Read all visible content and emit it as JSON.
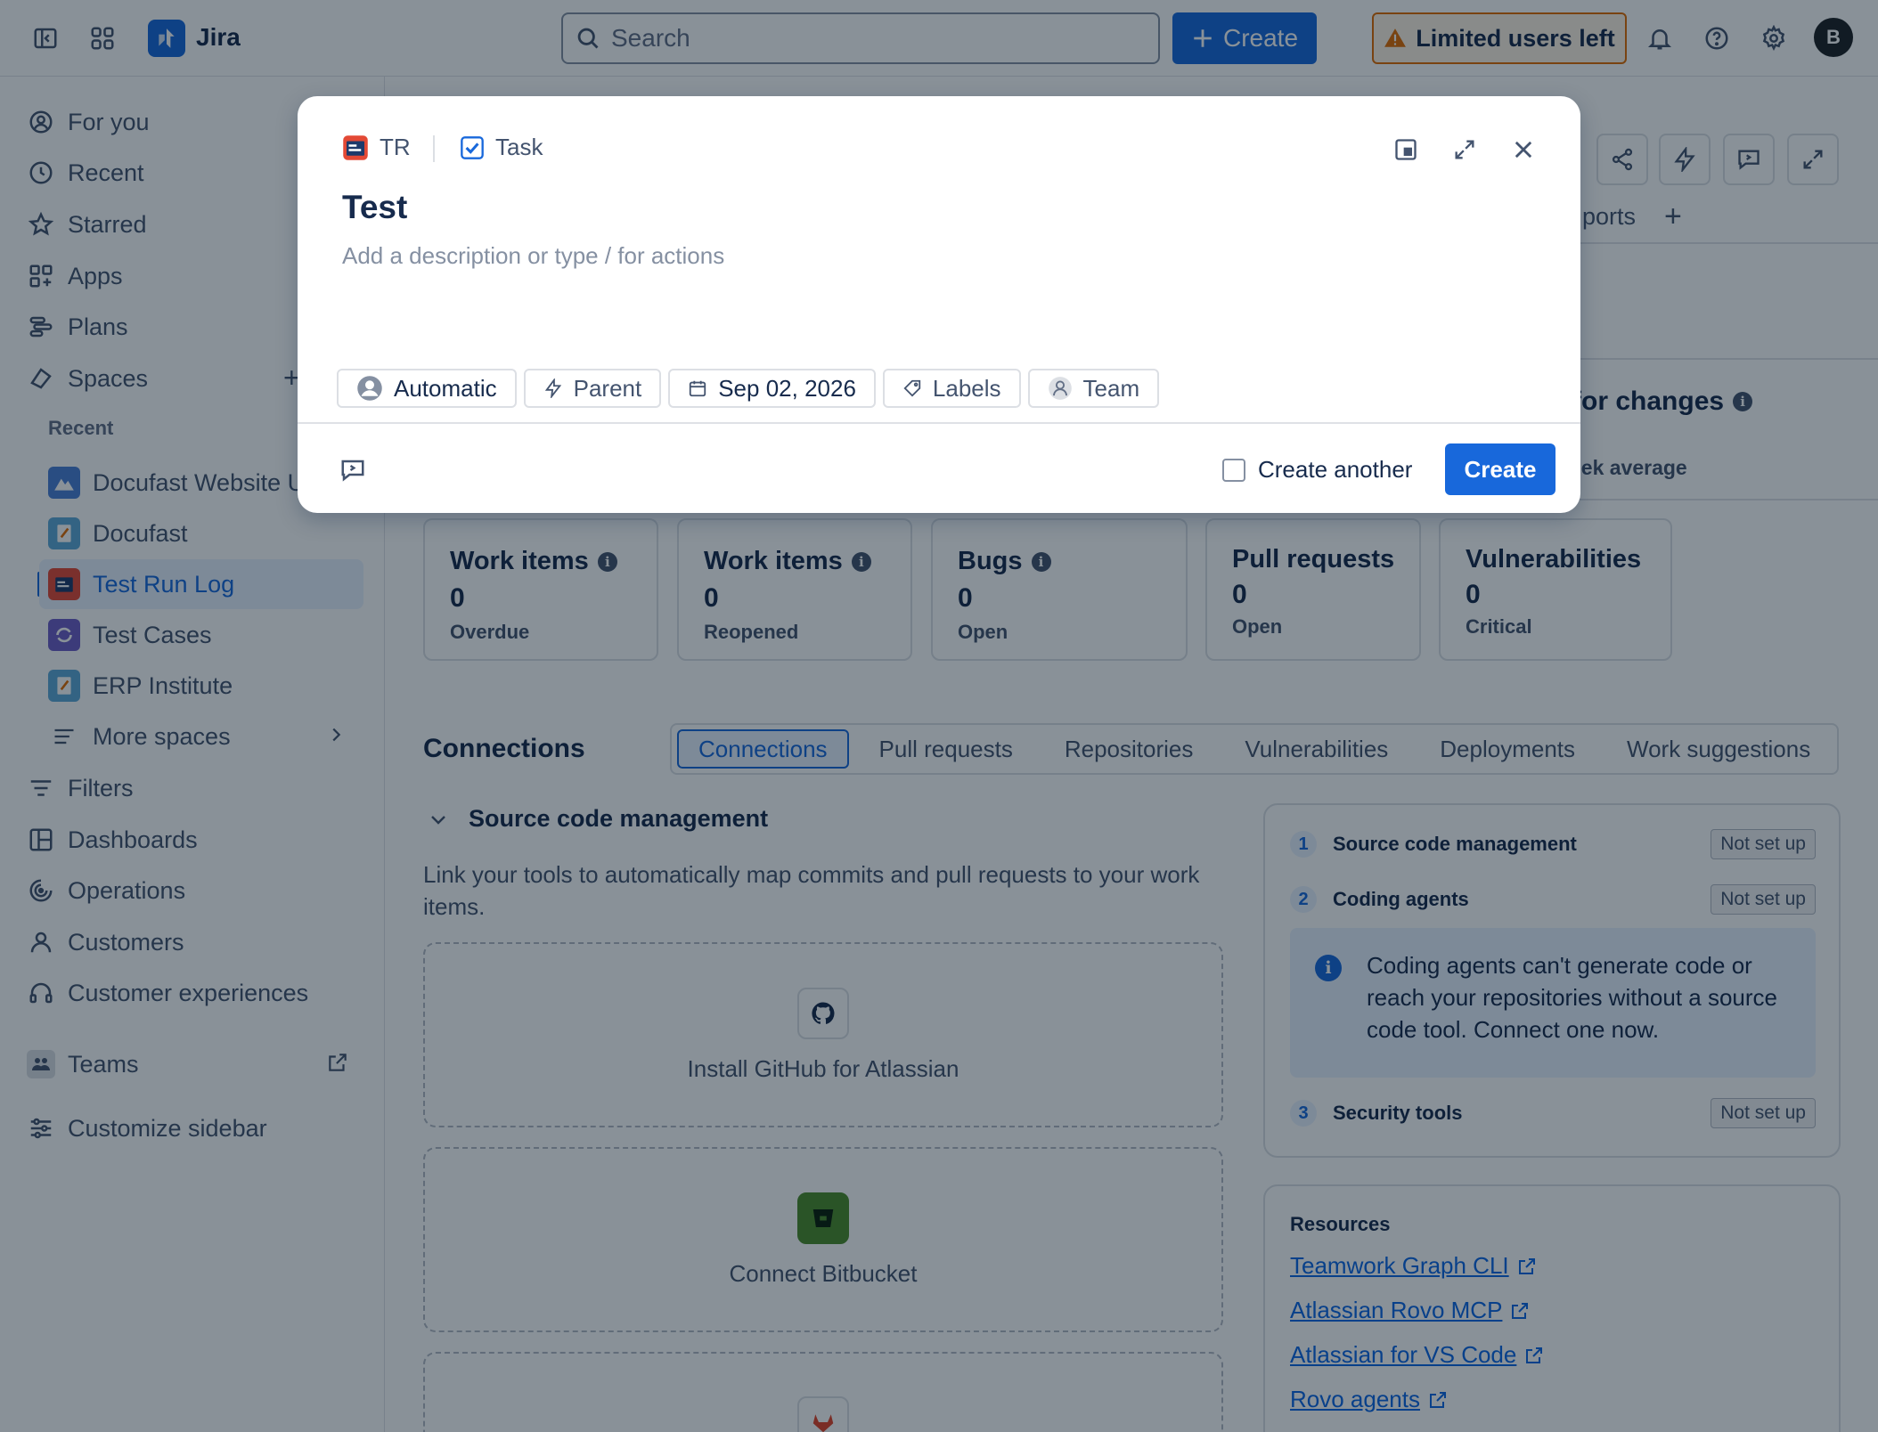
{
  "topnav": {
    "app_name": "Jira",
    "search_placeholder": "Search",
    "create_label": "Create",
    "limited_label": "Limited users left",
    "avatar_initial": "B"
  },
  "sidebar": {
    "items_top": [
      {
        "label": "For you",
        "icon": "user-circle-icon"
      },
      {
        "label": "Recent",
        "icon": "clock-icon"
      },
      {
        "label": "Starred",
        "icon": "star-icon"
      },
      {
        "label": "Apps",
        "icon": "apps-icon"
      },
      {
        "label": "Plans",
        "icon": "plans-icon"
      },
      {
        "label": "Spaces",
        "icon": "spaces-icon"
      }
    ],
    "recent_heading": "Recent",
    "spaces": [
      {
        "label": "Docufast Website U",
        "color": "#4a7fd6"
      },
      {
        "label": "Docufast",
        "color": "#5ea8d8"
      },
      {
        "label": "Test Run Log",
        "color": "#e34935"
      },
      {
        "label": "Test Cases",
        "color": "#6e5dc6"
      },
      {
        "label": "ERP Institute",
        "color": "#5ea8d8"
      }
    ],
    "more_spaces": "More spaces",
    "items_bottom": [
      {
        "label": "Filters",
        "icon": "filter-icon"
      },
      {
        "label": "Dashboards",
        "icon": "dashboard-icon"
      },
      {
        "label": "Operations",
        "icon": "operations-icon"
      },
      {
        "label": "Customers",
        "icon": "person-icon"
      },
      {
        "label": "Customer experiences",
        "icon": "headset-icon"
      }
    ],
    "teams": "Teams",
    "customize": "Customize sidebar"
  },
  "main": {
    "ports_tab": "ports",
    "changes_title": "e for changes",
    "week_avg": "eek average",
    "stats": [
      {
        "title": "Work items",
        "value": "0",
        "sub": "Overdue",
        "info": true
      },
      {
        "title": "Work items",
        "value": "0",
        "sub": "Reopened",
        "info": true
      },
      {
        "title": "Bugs",
        "value": "0",
        "sub": "Open",
        "info": true
      },
      {
        "title": "Pull requests",
        "value": "0",
        "sub": "Open",
        "info": false
      },
      {
        "title": "Vulnerabilities",
        "value": "0",
        "sub": "Critical",
        "info": false
      }
    ],
    "connections_title": "Connections",
    "tabs": [
      "Connections",
      "Pull requests",
      "Repositories",
      "Vulnerabilities",
      "Deployments",
      "Work suggestions"
    ],
    "scm_heading": "Source code management",
    "scm_desc": "Link your tools to automatically map commits and pull requests to your work items.",
    "tools": [
      {
        "label": "Install GitHub for Atlassian",
        "icon": "github-icon"
      },
      {
        "label": "Connect Bitbucket",
        "icon": "bitbucket-icon"
      },
      {
        "label": "",
        "icon": "gitlab-icon"
      }
    ],
    "steps": [
      {
        "num": "1",
        "label": "Source code management",
        "badge": "Not set up"
      },
      {
        "num": "2",
        "label": "Coding agents",
        "badge": "Not set up"
      },
      {
        "num": "3",
        "label": "Security tools",
        "badge": "Not set up"
      }
    ],
    "coding_info": "Coding agents can't generate code or reach your repositories without a source code tool. Connect one now.",
    "resources_title": "Resources",
    "resources": [
      "Teamwork Graph CLI",
      "Atlassian Rovo MCP",
      "Atlassian for VS Code",
      "Rovo agents"
    ]
  },
  "modal": {
    "project_key": "TR",
    "issue_type": "Task",
    "title": "Test",
    "description_placeholder": "Add a description or type / for actions",
    "fields": {
      "assignee": "Automatic",
      "parent": "Parent",
      "due_date": "Sep 02, 2026",
      "labels": "Labels",
      "team": "Team"
    },
    "create_another": "Create another",
    "create_button": "Create"
  },
  "colors": {
    "brand": "#1868db",
    "overlay": "rgba(5,21,36,0.47)"
  }
}
